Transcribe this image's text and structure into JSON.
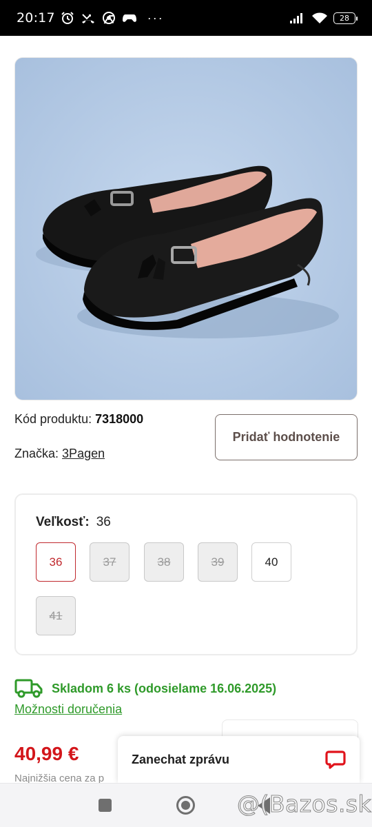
{
  "status_bar": {
    "time": "20:17",
    "battery": "28",
    "more": "···"
  },
  "product": {
    "image_alt": "black leather loafers with tassels",
    "code_label": "Kód produktu:",
    "code_value": "7318000",
    "brand_label": "Značka:",
    "brand_value": "3Pagen",
    "review_button": "Pridať hodnotenie"
  },
  "size_selector": {
    "label": "Veľkosť:",
    "selected": "36",
    "options": [
      {
        "value": "36",
        "state": "selected"
      },
      {
        "value": "37",
        "state": "unavailable"
      },
      {
        "value": "38",
        "state": "unavailable"
      },
      {
        "value": "39",
        "state": "unavailable"
      },
      {
        "value": "40",
        "state": "available"
      },
      {
        "value": "41",
        "state": "unavailable"
      }
    ]
  },
  "stock": {
    "text": "Skladom 6 ks (odosielame 16.06.2025)",
    "delivery_link": "Možnosti doručenia",
    "color": "#2f9a2a"
  },
  "price": {
    "value": "40,99 €",
    "lowest_price_text": "Najnižšia cena za p",
    "color": "#d3161b"
  },
  "chat": {
    "label": "Zanechat zprávu",
    "icon": "chat-bubble-icon",
    "color": "#e0131b"
  },
  "watermark": "@(Bazos.sk"
}
